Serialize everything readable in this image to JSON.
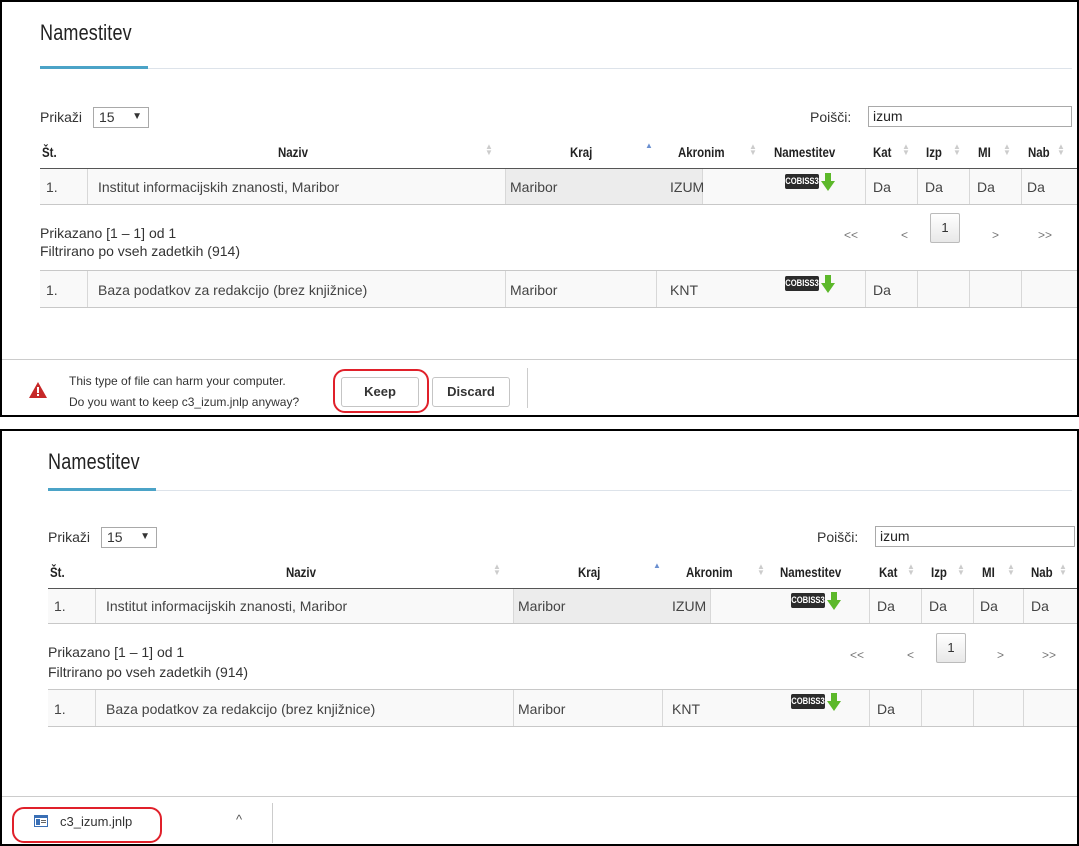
{
  "page": {
    "title": "Namestitev",
    "show_label": "Prikaži",
    "show_value": "15",
    "search_label": "Poišči:",
    "search_value": "izum",
    "columns": [
      "Št.",
      "Naziv",
      "Kraj",
      "Akronim",
      "Namestitev",
      "Kat",
      "Izp",
      "MI",
      "Nab"
    ],
    "rows": [
      {
        "num": "1.",
        "naziv": "Institut informacijskih znanosti, Maribor",
        "kraj": "Maribor",
        "akronim": "IZUM",
        "namestitev": "COBISS3",
        "kat": "Da",
        "izp": "Da",
        "mi": "Da",
        "nab": "Da"
      }
    ],
    "shown_info": "Prikazano [1 – 1] od 1",
    "filter_info": "Filtrirano po vseh zadetkih (914)",
    "pager": {
      "first": "<<",
      "prev": "<",
      "current": "1",
      "next": ">",
      "last": ">>"
    },
    "extra_row": {
      "num": "1.",
      "naziv": "Baza podatkov za redakcijo (brez knjižnice)",
      "kraj": "Maribor",
      "akronim": "KNT",
      "namestitev": "COBISS3",
      "kat": "Da"
    }
  },
  "download_warning": {
    "line1": "This type of file can harm your computer.",
    "line2": "Do you want to keep c3_izum.jnlp anyway?",
    "keep_label": "Keep",
    "discard_label": "Discard"
  },
  "download_item": {
    "file_name": "c3_izum.jnlp",
    "caret": "^"
  },
  "colors": {
    "accent": "#4ba3c7",
    "highlight_ring": "#e0202a",
    "warning": "#c62828"
  }
}
